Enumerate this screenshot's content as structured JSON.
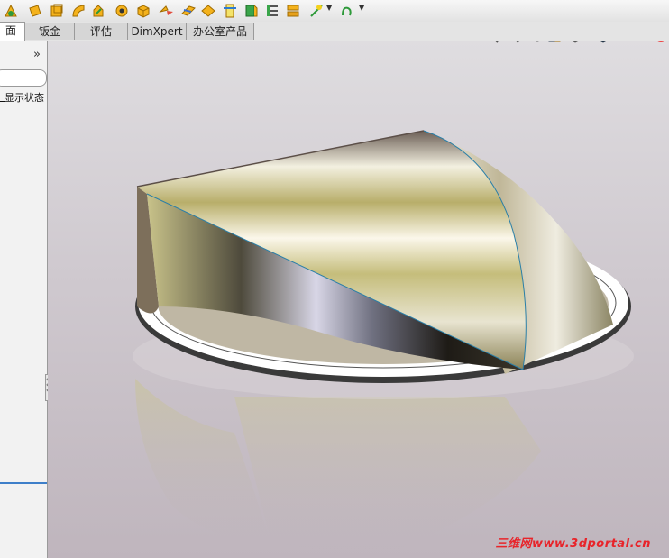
{
  "toolbar": {
    "icons": [
      "extruded-boss-icon",
      "revolved-boss-icon",
      "shell-icon",
      "sweep-icon",
      "loft-icon",
      "hole-wizard-icon",
      "insert-part-icon",
      "mirror-icon",
      "move-face-icon",
      "split-line-icon",
      "reference-geometry-icon",
      "section-view-icon",
      "curves-icon",
      "sketch-tools-icon",
      "spline-icon"
    ]
  },
  "tabs": [
    "面",
    "钣金",
    "评估",
    "DimXpert",
    "办公室产品"
  ],
  "left_panel": {
    "expand_label": "»",
    "display_state": "显示状态"
  },
  "view_toolbar": [
    "zoom-to-fit-icon",
    "zoom-to-area-icon",
    "previous-view-icon",
    "section-view-icon",
    "view-orientation-icon",
    "display-style-icon",
    "hide-show-items-icon",
    "appearance-icon"
  ],
  "watermark": "三维网www.3dportal.cn"
}
